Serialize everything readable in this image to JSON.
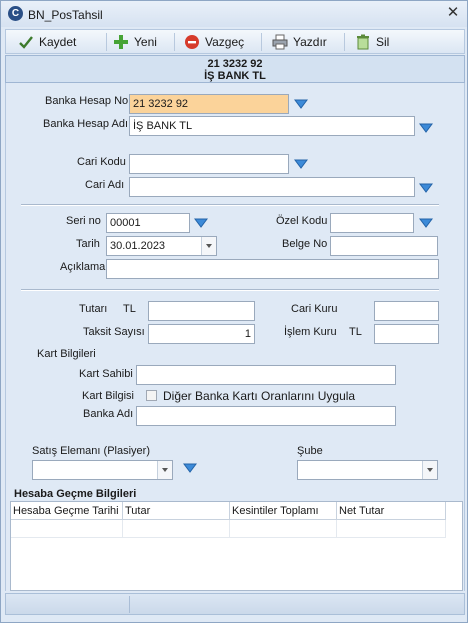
{
  "window": {
    "title": "BN_PosTahsil",
    "close": "✕"
  },
  "toolbar": {
    "save_label": "Kaydet",
    "new_label": "Yeni",
    "cancel_label": "Vazgeç",
    "print_label": "Yazdır",
    "delete_label": "Sil"
  },
  "header": {
    "line1": "21 3232 92",
    "line2": "İŞ BANK TL"
  },
  "form": {
    "bank_account_no_label": "Banka Hesap No",
    "bank_account_no_value": "21 3232 92",
    "bank_account_name_label": "Banka Hesap Adı",
    "bank_account_name_value": "İŞ BANK TL",
    "cari_code_label": "Cari Kodu",
    "cari_code_value": "",
    "cari_name_label": "Cari Adı",
    "cari_name_value": "",
    "serial_no_label": "Seri no",
    "serial_no_value": "00001",
    "special_code_label": "Özel Kodu",
    "special_code_value": "",
    "date_label": "Tarih",
    "date_value": "30.01.2023",
    "document_no_label": "Belge No",
    "document_no_value": "",
    "description_label": "Açıklama",
    "description_value": "",
    "amount_label": "Tutarı",
    "amount_currency": "TL",
    "amount_value": "",
    "cari_rate_label": "Cari Kuru",
    "cari_rate_value": "",
    "installment_label": "Taksit Sayısı",
    "installment_value": "1",
    "transaction_rate_label": "İşlem Kuru",
    "transaction_rate_currency": "TL",
    "transaction_rate_value": "",
    "card_info_header": "Kart Bilgileri",
    "card_holder_label": "Kart Sahibi",
    "card_holder_value": "",
    "card_info_label": "Kart Bilgisi",
    "other_bank_checkbox_label": "Diğer Banka Kartı Oranlarını Uygula",
    "bank_name_label": "Banka Adı",
    "bank_name_value": "",
    "salesperson_label": "Satış Elemanı (Plasiyer)",
    "salesperson_value": "",
    "branch_label": "Şube",
    "branch_value": ""
  },
  "grid": {
    "title": "Hesaba Geçme Bilgileri",
    "columns": [
      "Hesaba Geçme Tarihi",
      "Tutar",
      "Kesintiler Toplamı",
      "Net Tutar"
    ]
  },
  "colors": {
    "highlight_field": "#fbd39a",
    "accent": "#2a6bc2"
  }
}
